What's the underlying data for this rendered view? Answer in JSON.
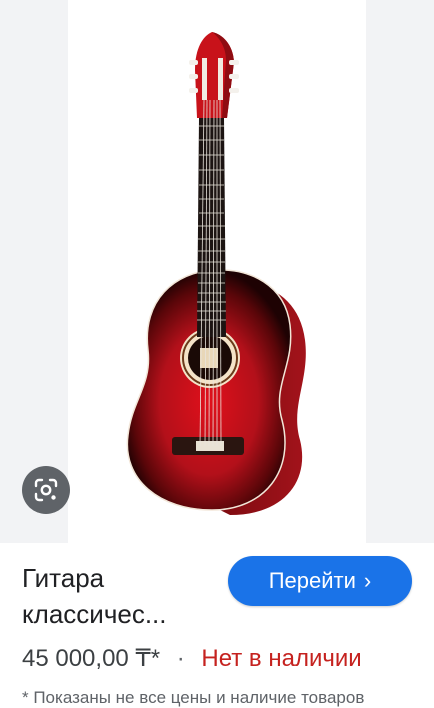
{
  "product": {
    "title_line1": "Гитара",
    "title_line2": "классичес...",
    "price": "45 000,00 ₸*",
    "separator": "·",
    "stock_status": "Нет в наличии",
    "footnote_partial": "* Показаны не все цены и наличие товаров"
  },
  "actions": {
    "go_label": "Перейти",
    "go_chevron": "›",
    "lens_icon": "lens-search-icon"
  },
  "colors": {
    "accent": "#1a73e8",
    "out_of_stock": "#c5221f",
    "guitar_red": "#c0141c"
  }
}
